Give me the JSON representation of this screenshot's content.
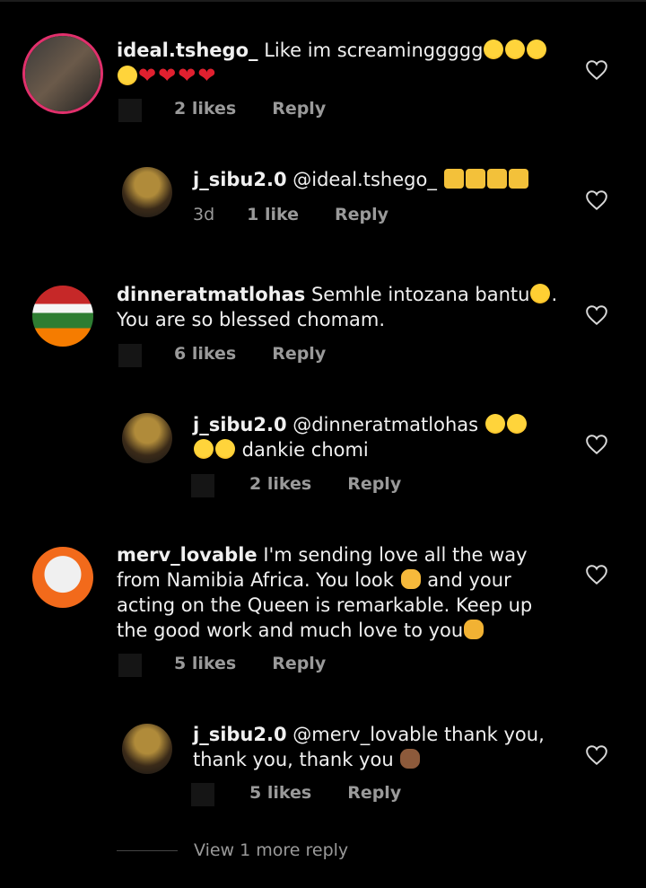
{
  "comments": [
    {
      "username": "ideal.tshego_",
      "text": " Like im screaminggggg",
      "likes": "2 likes",
      "reply": "Reply"
    },
    {
      "username": "j_sibu2.0",
      "text": " @ideal.tshego_",
      "time": "3d",
      "likes": "1 like",
      "reply": "Reply"
    },
    {
      "username": "dinneratmatlohas",
      "text": " Semhle intozana bantu",
      "text2": ".",
      "text3": "You are so blessed chomam.",
      "likes": "6 likes",
      "reply": "Reply"
    },
    {
      "username": "j_sibu2.0",
      "text": " @dinneratmatlohas",
      "text2": " dankie chomi",
      "likes": "2 likes",
      "reply": "Reply"
    },
    {
      "username": "merv_lovable",
      "text": " I'm sending love all the way",
      "text2": "from Namibia Africa. You look",
      "text3": " and your",
      "text4": "acting on the Queen is remarkable. Keep up",
      "text5": "the good work and much love to you",
      "likes": "5 likes",
      "reply": "Reply"
    },
    {
      "username": "j_sibu2.0",
      "text": " @merv_lovable thank you,",
      "text2": "thank you, thank you",
      "likes": "5 likes",
      "reply": "Reply"
    }
  ],
  "view_more": "View 1 more reply",
  "icons": {
    "heart": "heart-outline-icon",
    "crying": "loudly-crying-face-emoji",
    "red_heart": "red-heart-emoji",
    "speaker": "speaker-loud-emoji",
    "kiss": "face-blowing-kiss-emoji",
    "heart_eyes": "heart-eyes-emoji",
    "ok_hand": "ok-hand-emoji",
    "raised_hands": "raising-hands-emoji",
    "pray": "folded-hands-emoji"
  },
  "colors": {
    "background": "#000000",
    "text": "#f0f0f0",
    "meta": "#9a9a9a",
    "story_ring": "#e1306c"
  }
}
